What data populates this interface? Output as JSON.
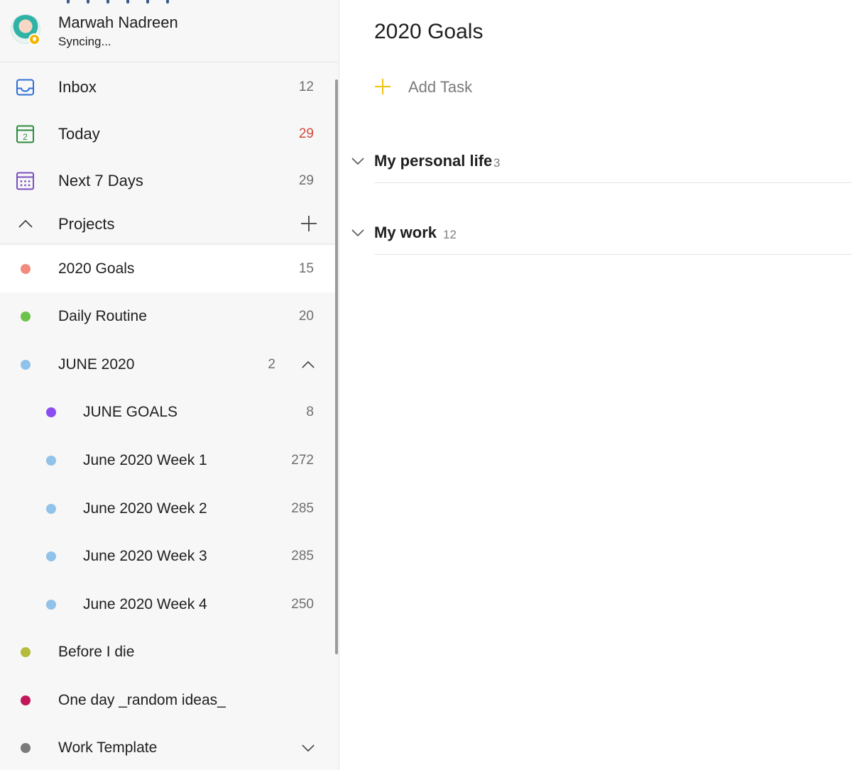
{
  "profile": {
    "name": "Marwah Nadreen",
    "status": "Syncing..."
  },
  "nav": {
    "inbox": {
      "label": "Inbox",
      "count": "12",
      "icon": "inbox-icon"
    },
    "today": {
      "label": "Today",
      "count": "29",
      "icon": "calendar-today-icon",
      "day": "2"
    },
    "next7": {
      "label": "Next 7 Days",
      "count": "29",
      "icon": "calendar-week-icon"
    }
  },
  "projects": {
    "header": "Projects",
    "items": [
      {
        "label": "2020 Goals",
        "count": "15",
        "color": "#f28b7d"
      },
      {
        "label": "Daily Routine",
        "count": "20",
        "color": "#6cc24a"
      },
      {
        "label": "JUNE 2020",
        "count": "2",
        "color": "#90c2ea"
      },
      {
        "label": "JUNE GOALS",
        "count": "8",
        "color": "#8b4cf0"
      },
      {
        "label": "June 2020 Week 1",
        "count": "272",
        "color": "#90c2ea"
      },
      {
        "label": "June 2020 Week 2",
        "count": "285",
        "color": "#90c2ea"
      },
      {
        "label": "June 2020 Week 3",
        "count": "285",
        "color": "#90c2ea"
      },
      {
        "label": "June 2020 Week 4",
        "count": "250",
        "color": "#90c2ea"
      },
      {
        "label": "Before I die",
        "count": "",
        "color": "#b5bb3b"
      },
      {
        "label": "One day _random ideas_",
        "count": "",
        "color": "#c2185b"
      },
      {
        "label": "Work Template",
        "count": "",
        "color": "#7a7a7a"
      }
    ]
  },
  "main": {
    "title": "2020 Goals",
    "add_task": "Add Task",
    "sections": [
      {
        "title": "My personal life",
        "count": "3"
      },
      {
        "title": "My work",
        "count": "12"
      }
    ]
  },
  "colors": {
    "accent_yellow": "#f4c20d",
    "inbox_blue": "#2f6fd6",
    "today_green": "#2e8b3e",
    "week_purple": "#7a4fc0"
  }
}
